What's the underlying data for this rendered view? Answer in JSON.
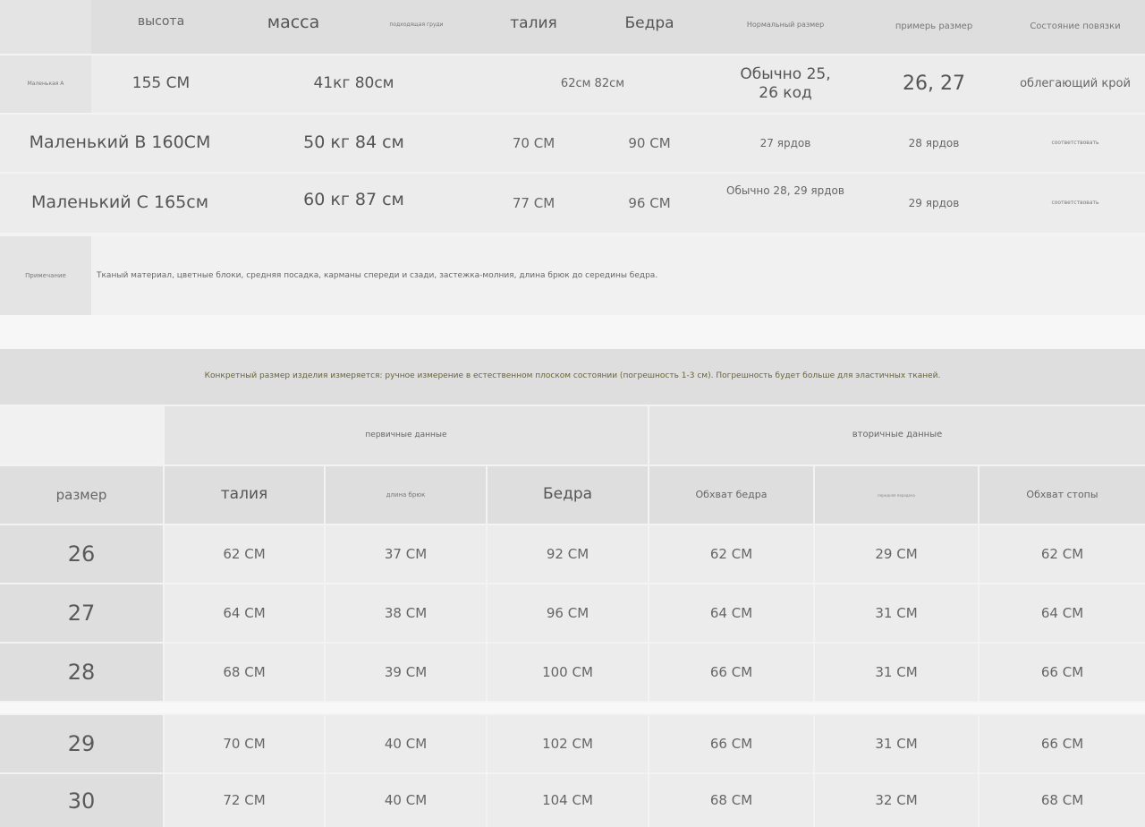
{
  "top_table": {
    "headers": [
      "высота",
      "масса",
      "подходящая груди",
      "талия",
      "Бедра",
      "Нормальный размер",
      "примерь размер",
      "Состояние повязки"
    ],
    "rows": [
      {
        "label": "Маленькая А",
        "height": "155 СМ",
        "weight_chest": "41кг 80см",
        "waist_hips": "62см 82см",
        "normal_size": "Обычно 25, 26 код",
        "fit_size": "26, 27",
        "state": "облегающий крой"
      },
      {
        "label_height": "Маленький В 160СМ",
        "weight_chest": "50 кг 84 см",
        "waist": "70 СМ",
        "hips": "90 СМ",
        "normal_size": "27 ярдов",
        "fit_size": "28 ярдов",
        "state": "соответствовать"
      },
      {
        "label_height": "Маленький С 165см",
        "weight_chest": "60 кг 87 см",
        "waist": "77 СМ",
        "hips": "96 СМ",
        "normal_size": "Обычно 28, 29 ярдов",
        "fit_size": "29 ярдов",
        "state": "соответствовать"
      }
    ],
    "note_label": "Примечание",
    "note_text": "Тканый материал, цветные блоки, средняя посадка, карманы спереди и сзади, застежка-молния, длина брюк до середины бедра."
  },
  "measurement_note": "Конкретный размер изделия измеряется: ручное измерение в естественном плоском состоянии (погрешность 1-3 см). Погрешность будет больше для эластичных тканей.",
  "bottom_table": {
    "group_primary": "первичные данные",
    "group_secondary": "вторичные данные",
    "headers": [
      "размер",
      "талия",
      "длина брюк",
      "Бедра",
      "Обхват бедра",
      "передняя передача",
      "Обхват стопы"
    ],
    "rows": [
      [
        "26",
        "62 СМ",
        "37 СМ",
        "92 СМ",
        "62 СМ",
        "29 СМ",
        "62 СМ"
      ],
      [
        "27",
        "64 СМ",
        "38 СМ",
        "96 СМ",
        "64 СМ",
        "31 СМ",
        "64 СМ"
      ],
      [
        "28",
        "68 СМ",
        "39 СМ",
        "100 СМ",
        "66 СМ",
        "31 СМ",
        "66 СМ"
      ],
      [
        "29",
        "70 СМ",
        "40 СМ",
        "102 СМ",
        "66 СМ",
        "31 СМ",
        "66 СМ"
      ],
      [
        "30",
        "72 СМ",
        "40 СМ",
        "104 СМ",
        "68 СМ",
        "32 СМ",
        "68 СМ"
      ]
    ]
  }
}
